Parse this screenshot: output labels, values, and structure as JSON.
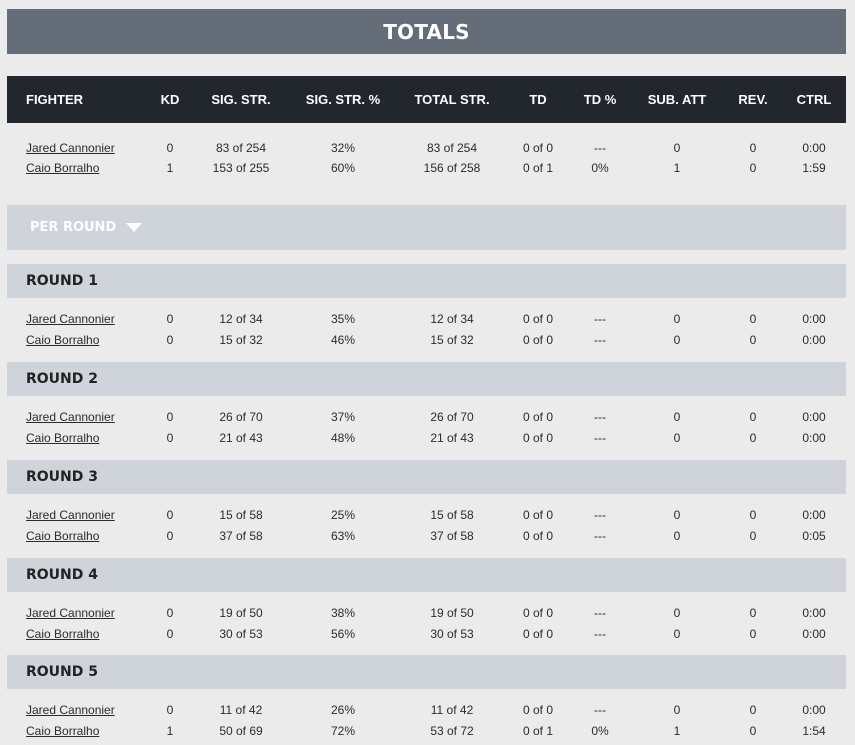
{
  "totals_title": "TOTALS",
  "headers": {
    "fighter": "FIGHTER",
    "kd": "KD",
    "sig_str": "SIG. STR.",
    "sig_str_pct": "SIG. STR. %",
    "total_str": "TOTAL STR.",
    "td": "TD",
    "td_pct": "TD %",
    "sub_att": "SUB. ATT",
    "rev": "REV.",
    "ctrl": "CTRL"
  },
  "totals": [
    {
      "fighter": "Jared Cannonier",
      "kd": "0",
      "sig_str": "83 of 254",
      "sig_str_pct": "32%",
      "total_str": "83 of 254",
      "td": "0 of 0",
      "td_pct": "---",
      "sub_att": "0",
      "rev": "0",
      "ctrl": "0:00"
    },
    {
      "fighter": "Caio Borralho",
      "kd": "1",
      "sig_str": "153 of 255",
      "sig_str_pct": "60%",
      "total_str": "156 of 258",
      "td": "0 of 1",
      "td_pct": "0%",
      "sub_att": "1",
      "rev": "0",
      "ctrl": "1:59"
    }
  ],
  "per_round_label": "PER ROUND",
  "rounds": [
    {
      "title": "ROUND 1",
      "rows": [
        {
          "fighter": "Jared Cannonier",
          "kd": "0",
          "sig_str": "12 of 34",
          "sig_str_pct": "35%",
          "total_str": "12 of 34",
          "td": "0 of 0",
          "td_pct": "---",
          "sub_att": "0",
          "rev": "0",
          "ctrl": "0:00"
        },
        {
          "fighter": "Caio Borralho",
          "kd": "0",
          "sig_str": "15 of 32",
          "sig_str_pct": "46%",
          "total_str": "15 of 32",
          "td": "0 of 0",
          "td_pct": "---",
          "sub_att": "0",
          "rev": "0",
          "ctrl": "0:00"
        }
      ]
    },
    {
      "title": "ROUND 2",
      "rows": [
        {
          "fighter": "Jared Cannonier",
          "kd": "0",
          "sig_str": "26 of 70",
          "sig_str_pct": "37%",
          "total_str": "26 of 70",
          "td": "0 of 0",
          "td_pct": "---",
          "sub_att": "0",
          "rev": "0",
          "ctrl": "0:00"
        },
        {
          "fighter": "Caio Borralho",
          "kd": "0",
          "sig_str": "21 of 43",
          "sig_str_pct": "48%",
          "total_str": "21 of 43",
          "td": "0 of 0",
          "td_pct": "---",
          "sub_att": "0",
          "rev": "0",
          "ctrl": "0:00"
        }
      ]
    },
    {
      "title": "ROUND 3",
      "rows": [
        {
          "fighter": "Jared Cannonier",
          "kd": "0",
          "sig_str": "15 of 58",
          "sig_str_pct": "25%",
          "total_str": "15 of 58",
          "td": "0 of 0",
          "td_pct": "---",
          "sub_att": "0",
          "rev": "0",
          "ctrl": "0:00"
        },
        {
          "fighter": "Caio Borralho",
          "kd": "0",
          "sig_str": "37 of 58",
          "sig_str_pct": "63%",
          "total_str": "37 of 58",
          "td": "0 of 0",
          "td_pct": "---",
          "sub_att": "0",
          "rev": "0",
          "ctrl": "0:05"
        }
      ]
    },
    {
      "title": "ROUND 4",
      "rows": [
        {
          "fighter": "Jared Cannonier",
          "kd": "0",
          "sig_str": "19 of 50",
          "sig_str_pct": "38%",
          "total_str": "19 of 50",
          "td": "0 of 0",
          "td_pct": "---",
          "sub_att": "0",
          "rev": "0",
          "ctrl": "0:00"
        },
        {
          "fighter": "Caio Borralho",
          "kd": "0",
          "sig_str": "30 of 53",
          "sig_str_pct": "56%",
          "total_str": "30 of 53",
          "td": "0 of 0",
          "td_pct": "---",
          "sub_att": "0",
          "rev": "0",
          "ctrl": "0:00"
        }
      ]
    },
    {
      "title": "ROUND 5",
      "rows": [
        {
          "fighter": "Jared Cannonier",
          "kd": "0",
          "sig_str": "11 of 42",
          "sig_str_pct": "26%",
          "total_str": "11 of 42",
          "td": "0 of 0",
          "td_pct": "---",
          "sub_att": "0",
          "rev": "0",
          "ctrl": "0:00"
        },
        {
          "fighter": "Caio Borralho",
          "kd": "1",
          "sig_str": "50 of 69",
          "sig_str_pct": "72%",
          "total_str": "53 of 72",
          "td": "0 of 1",
          "td_pct": "0%",
          "sub_att": "1",
          "rev": "0",
          "ctrl": "1:54"
        }
      ]
    }
  ],
  "colors": {
    "totals_bar": "#646d78",
    "header_bar": "#22272d",
    "round_bar": "#cfd3da",
    "page_bg": "#ebebeb"
  }
}
